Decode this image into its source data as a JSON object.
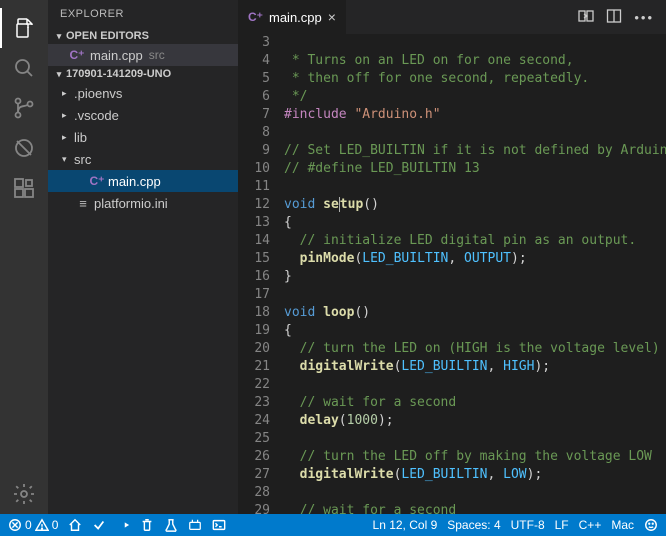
{
  "sidebar": {
    "title": "EXPLORER",
    "openEditors": {
      "label": "OPEN EDITORS",
      "items": [
        {
          "name": "main.cpp",
          "dir": "src"
        }
      ]
    },
    "project": {
      "label": "170901-141209-UNO",
      "tree": [
        {
          "name": ".pioenvs",
          "type": "folder",
          "expanded": false
        },
        {
          "name": ".vscode",
          "type": "folder",
          "expanded": false
        },
        {
          "name": "lib",
          "type": "folder",
          "expanded": false
        },
        {
          "name": "src",
          "type": "folder",
          "expanded": true
        },
        {
          "name": "main.cpp",
          "type": "file",
          "parent": "src",
          "active": true
        },
        {
          "name": "platformio.ini",
          "type": "file"
        }
      ]
    }
  },
  "tab": {
    "label": "main.cpp"
  },
  "code": {
    "startLine": 3,
    "lines": [
      {
        "n": 3,
        "tokens": []
      },
      {
        "n": 4,
        "tokens": [
          {
            "t": " * Turns on an LED on for one second,",
            "c": "tk-c"
          }
        ]
      },
      {
        "n": 5,
        "tokens": [
          {
            "t": " * then off for one second, repeatedly.",
            "c": "tk-c"
          }
        ]
      },
      {
        "n": 6,
        "tokens": [
          {
            "t": " */",
            "c": "tk-c"
          }
        ]
      },
      {
        "n": 7,
        "tokens": [
          {
            "t": "#include",
            "c": "tk-pp"
          },
          {
            "t": " "
          },
          {
            "t": "\"Arduino.h\"",
            "c": "tk-s"
          }
        ]
      },
      {
        "n": 8,
        "tokens": []
      },
      {
        "n": 9,
        "tokens": [
          {
            "t": "// Set LED_BUILTIN if it is not defined by Arduino",
            "c": "tk-c"
          }
        ]
      },
      {
        "n": 10,
        "tokens": [
          {
            "t": "// #define LED_BUILTIN 13",
            "c": "tk-c"
          }
        ]
      },
      {
        "n": 11,
        "tokens": []
      },
      {
        "n": 12,
        "tokens": [
          {
            "t": "void",
            "c": "tk-k"
          },
          {
            "t": " "
          },
          {
            "t": "se",
            "c": "tk-fn"
          },
          {
            "t": "",
            "cursor": true
          },
          {
            "t": "tup",
            "c": "tk-fn"
          },
          {
            "t": "()"
          }
        ]
      },
      {
        "n": 13,
        "tokens": [
          {
            "t": "{"
          }
        ]
      },
      {
        "n": 14,
        "tokens": [
          {
            "t": "  "
          },
          {
            "t": "// initialize LED digital pin as an output.",
            "c": "tk-c"
          }
        ]
      },
      {
        "n": 15,
        "tokens": [
          {
            "t": "  "
          },
          {
            "t": "pinMode",
            "c": "tk-fn"
          },
          {
            "t": "("
          },
          {
            "t": "LED_BUILTIN",
            "c": "tk-kc"
          },
          {
            "t": ", "
          },
          {
            "t": "OUTPUT",
            "c": "tk-kc"
          },
          {
            "t": ");"
          }
        ]
      },
      {
        "n": 16,
        "tokens": [
          {
            "t": "}"
          }
        ]
      },
      {
        "n": 17,
        "tokens": []
      },
      {
        "n": 18,
        "tokens": [
          {
            "t": "void",
            "c": "tk-k"
          },
          {
            "t": " "
          },
          {
            "t": "loop",
            "c": "tk-fn"
          },
          {
            "t": "()"
          }
        ]
      },
      {
        "n": 19,
        "tokens": [
          {
            "t": "{"
          }
        ]
      },
      {
        "n": 20,
        "tokens": [
          {
            "t": "  "
          },
          {
            "t": "// turn the LED on (HIGH is the voltage level)",
            "c": "tk-c"
          }
        ]
      },
      {
        "n": 21,
        "tokens": [
          {
            "t": "  "
          },
          {
            "t": "digitalWrite",
            "c": "tk-fn"
          },
          {
            "t": "("
          },
          {
            "t": "LED_BUILTIN",
            "c": "tk-kc"
          },
          {
            "t": ", "
          },
          {
            "t": "HIGH",
            "c": "tk-kc"
          },
          {
            "t": ");"
          }
        ]
      },
      {
        "n": 22,
        "tokens": []
      },
      {
        "n": 23,
        "tokens": [
          {
            "t": "  "
          },
          {
            "t": "// wait for a second",
            "c": "tk-c"
          }
        ]
      },
      {
        "n": 24,
        "tokens": [
          {
            "t": "  "
          },
          {
            "t": "delay",
            "c": "tk-fn"
          },
          {
            "t": "("
          },
          {
            "t": "1000",
            "c": "tk-n"
          },
          {
            "t": ");"
          }
        ]
      },
      {
        "n": 25,
        "tokens": []
      },
      {
        "n": 26,
        "tokens": [
          {
            "t": "  "
          },
          {
            "t": "// turn the LED off by making the voltage LOW",
            "c": "tk-c"
          }
        ]
      },
      {
        "n": 27,
        "tokens": [
          {
            "t": "  "
          },
          {
            "t": "digitalWrite",
            "c": "tk-fn"
          },
          {
            "t": "("
          },
          {
            "t": "LED_BUILTIN",
            "c": "tk-kc"
          },
          {
            "t": ", "
          },
          {
            "t": "LOW",
            "c": "tk-kc"
          },
          {
            "t": ");"
          }
        ]
      },
      {
        "n": 28,
        "tokens": []
      },
      {
        "n": 29,
        "tokens": [
          {
            "t": "  "
          },
          {
            "t": "// wait for a second",
            "c": "tk-c"
          }
        ]
      }
    ]
  },
  "status": {
    "errors": "0",
    "warnings": "0",
    "lncol": "Ln 12, Col 9",
    "spaces": "Spaces: 4",
    "encoding": "UTF-8",
    "eol": "LF",
    "lang": "C++",
    "os": "Mac"
  }
}
